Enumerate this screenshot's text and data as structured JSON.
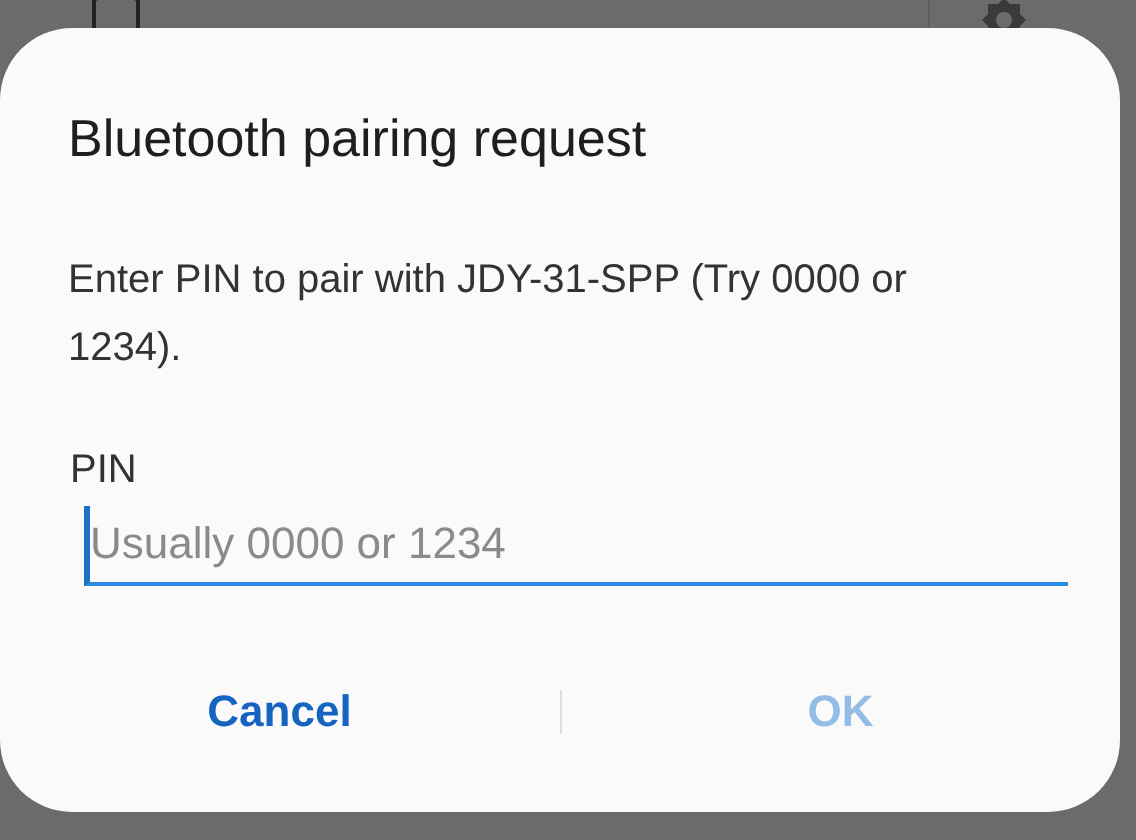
{
  "dialog": {
    "title": "Bluetooth pairing request",
    "message": "Enter PIN to pair with JDY-31-SPP (Try 0000 or 1234).",
    "field": {
      "label": "PIN",
      "placeholder": "Usually 0000 or 1234"
    },
    "buttons": [
      {
        "label": "Cancel",
        "disabled": false
      },
      {
        "label": "OK",
        "disabled": true
      }
    ]
  }
}
